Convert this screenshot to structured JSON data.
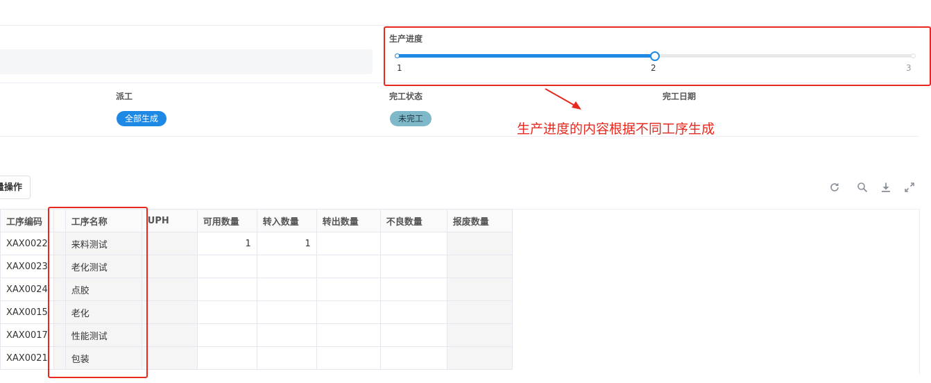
{
  "progress": {
    "label": "生产进度",
    "min": 1,
    "max": 3,
    "value": 2,
    "marks": [
      "1",
      "2",
      "3"
    ]
  },
  "fields": {
    "dispatch_label": "派工",
    "dispatch_value": "全部生成",
    "completion_status_label": "完工状态",
    "completion_status_value": "未完工",
    "completion_date_label": "完工日期"
  },
  "annotation": "生产进度的内容根据不同工序生成",
  "toolbar": {
    "batch_button": "批量操作",
    "batch_button_visible": "量操作",
    "icons": [
      "refresh-icon",
      "search-icon",
      "download-icon",
      "fullscreen-icon"
    ]
  },
  "table": {
    "columns": [
      "工序编码",
      "工序名称",
      "UPH",
      "可用数量",
      "转入数量",
      "转出数量",
      "不良数量",
      "报废数量"
    ],
    "rows": [
      [
        "XAX0022",
        "来料测试",
        "",
        "1",
        "1",
        "",
        "",
        ""
      ],
      [
        "XAX0023",
        "老化测试",
        "",
        "",
        "",
        "",
        "",
        ""
      ],
      [
        "XAX0024",
        "点胶",
        "",
        "",
        "",
        "",
        "",
        ""
      ],
      [
        "XAX0015",
        "老化",
        "",
        "",
        "",
        "",
        "",
        ""
      ],
      [
        "XAX0017",
        "性能测试",
        "",
        "",
        "",
        "",
        "",
        ""
      ],
      [
        "XAX0021",
        "包装",
        "",
        "",
        "",
        "",
        "",
        ""
      ]
    ]
  },
  "colors": {
    "accent": "#1e88e5",
    "dispatch_pill": "#1e88e5",
    "status_pill": "#7fb8c8",
    "annotation_red": "#e8281e"
  }
}
